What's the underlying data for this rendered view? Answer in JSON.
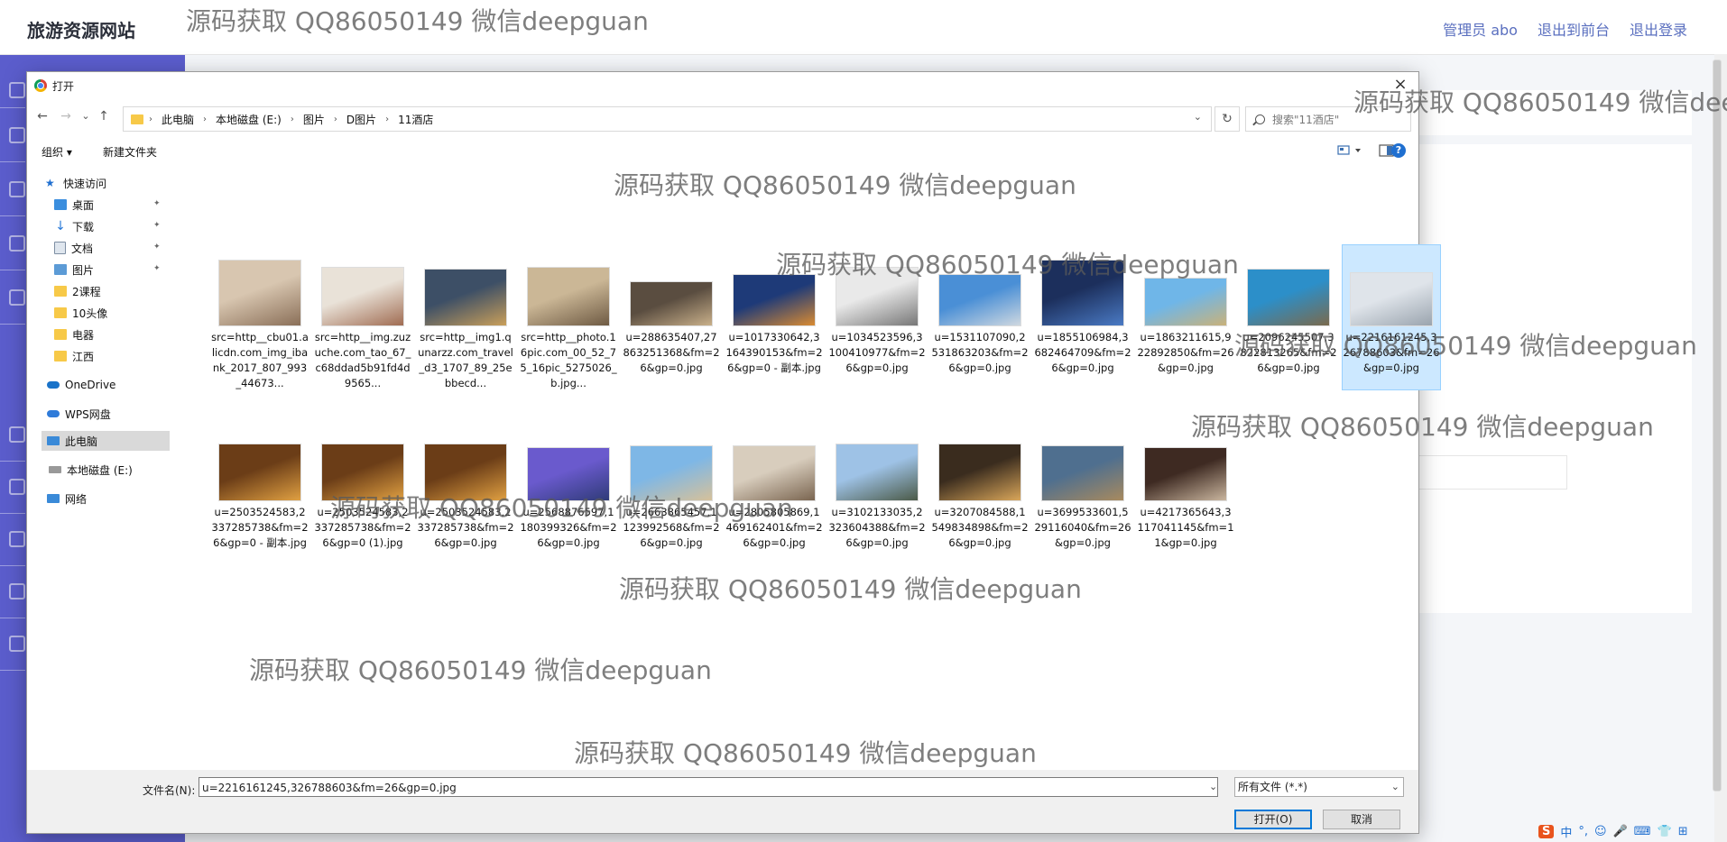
{
  "app": {
    "site_title": "旅游资源网站",
    "top_links": [
      "管理员 abo",
      "退出到前台",
      "退出登录"
    ]
  },
  "dialog": {
    "title": "打开",
    "close_glyph": "×",
    "nav_glyphs": {
      "back": "←",
      "forward": "→",
      "recent": "⌄",
      "up": "↑",
      "refresh": "↻",
      "address_dropdown": "⌄"
    },
    "breadcrumb": [
      "此电脑",
      "本地磁盘 (E:)",
      "图片",
      "D图片",
      "11酒店"
    ],
    "search_placeholder": "搜索\"11酒店\"",
    "commands": {
      "organize": "组织 ▾",
      "new_folder": "新建文件夹",
      "help": "?"
    },
    "nav_items": [
      {
        "label": "快速访问",
        "icon": "star-icon",
        "color": "#1f6fd0"
      },
      {
        "label": "桌面",
        "icon": "desktop-folder-icon",
        "color": "#3b8ede",
        "pinned": true
      },
      {
        "label": "下载",
        "icon": "download-icon",
        "color": "#2a7ad8",
        "pinned": true
      },
      {
        "label": "文档",
        "icon": "document-icon",
        "color": "#7d8ea3",
        "pinned": true
      },
      {
        "label": "图片",
        "icon": "pictures-icon",
        "color": "#5c9bd6",
        "pinned": true
      },
      {
        "label": "2课程",
        "icon": "folder-icon",
        "color": "#f7c948"
      },
      {
        "label": "10头像",
        "icon": "folder-icon",
        "color": "#f7c948"
      },
      {
        "label": "电器",
        "icon": "folder-icon",
        "color": "#f7c948"
      },
      {
        "label": "江西",
        "icon": "folder-icon",
        "color": "#f7c948"
      },
      {
        "label": "OneDrive",
        "icon": "cloud-icon",
        "color": "#1a73c9"
      },
      {
        "label": "WPS网盘",
        "icon": "cloud-icon",
        "color": "#2f7bd9"
      },
      {
        "label": "此电脑",
        "icon": "computer-icon",
        "color": "#3a8ad8",
        "selected": true
      },
      {
        "label": "本地磁盘 (E:)",
        "icon": "drive-icon",
        "color": "#777777"
      },
      {
        "label": "网络",
        "icon": "network-icon",
        "color": "#3a8ad8"
      }
    ],
    "pin_glyph": "📌",
    "files": [
      {
        "name": "src=http__cbu01.alicdn.com_img_ibank_2017_807_993_44673...",
        "c1": "#d8c6b0",
        "c2": "#8a6f58"
      },
      {
        "name": "src=http__img.zuzuche.com_tao_67_c68ddad5b91fd4d9565...",
        "c1": "#e9e2d8",
        "c2": "#a06c52"
      },
      {
        "name": "src=http__img1.qunarzz.com_travel_d3_1707_89_25ebbecd...",
        "c1": "#3d4f66",
        "c2": "#c99f5a"
      },
      {
        "name": "src=http__photo.16pic.com_00_52_75_16pic_5275026_b.jpg...",
        "c1": "#cbb796",
        "c2": "#6e5a43"
      },
      {
        "name": "u=288635407,27863251368&fm=26&gp=0.jpg",
        "c1": "#5a4d40",
        "c2": "#c9b08a"
      },
      {
        "name": "u=1017330642,3164390153&fm=26&gp=0 - 副本.jpg",
        "c1": "#1e3a78",
        "c2": "#d98b32"
      },
      {
        "name": "u=1034523596,3100410977&fm=26&gp=0.jpg",
        "c1": "#e9e9e9",
        "c2": "#777777"
      },
      {
        "name": "u=1531107090,2531863203&fm=26&gp=0.jpg",
        "c1": "#4a8fd6",
        "c2": "#cfd8e0"
      },
      {
        "name": "u=1855106984,3682464709&fm=26&gp=0.jpg",
        "c1": "#1c2f5c",
        "c2": "#4a7ac4"
      },
      {
        "name": "u=1863211615,922892850&fm=26&gp=0.jpg",
        "c1": "#6fb6e8",
        "c2": "#c9b27a"
      },
      {
        "name": "u=2096245507,3822813265&fm=26&gp=0.jpg",
        "c1": "#2c8fc9",
        "c2": "#7a6a4d"
      },
      {
        "name": "u=2216161245,326788603&fm=26&gp=0.jpg",
        "c1": "#dfe4ea",
        "c2": "#9aa4ae",
        "selected": true
      },
      {
        "name": "u=2503524583,2337285738&fm=26&gp=0 - 副本.jpg",
        "c1": "#6b3d17",
        "c2": "#e0a042"
      },
      {
        "name": "u=2503524583,2337285738&fm=26&gp=0 (1).jpg",
        "c1": "#6b3d17",
        "c2": "#e0a042"
      },
      {
        "name": "u=2503524583,2337285738&fm=26&gp=0.jpg",
        "c1": "#6b3d17",
        "c2": "#e0a042"
      },
      {
        "name": "u=2568876597,1180399326&fm=26&gp=0.jpg",
        "c1": "#6a5acd",
        "c2": "#2f3b78"
      },
      {
        "name": "u=2663865457,1123992568&fm=26&gp=0.jpg",
        "c1": "#7eb7e6",
        "c2": "#d6c19a"
      },
      {
        "name": "u=2805805869,1469162401&fm=26&gp=0.jpg",
        "c1": "#d8cdbd",
        "c2": "#7a6550"
      },
      {
        "name": "u=3102133035,2323604388&fm=26&gp=0.jpg",
        "c1": "#9ec2e6",
        "c2": "#4b5a48"
      },
      {
        "name": "u=3207084588,1549834898&fm=26&gp=0.jpg",
        "c1": "#3a2c1e",
        "c2": "#d9a65a"
      },
      {
        "name": "u=3699533601,529116040&fm=26&gp=0.jpg",
        "c1": "#4f6f8f",
        "c2": "#a88a5e"
      },
      {
        "name": "u=4217365643,3117041145&fm=11&gp=0.jpg",
        "c1": "#3e2a22",
        "c2": "#c9b59e"
      }
    ],
    "filename_label": "文件名(N):",
    "filename_value": "u=2216161245,326788603&fm=26&gp=0.jpg",
    "filetype": "所有文件 (*.*)",
    "open_button": "打开(O)",
    "cancel_button": "取消"
  },
  "watermarks": [
    "源码获取 QQ86050149 微信deepguan"
  ],
  "ime_bar": [
    "S",
    "中",
    "°,",
    "☺",
    "🎤",
    "⌨",
    "👕",
    "⊞"
  ]
}
